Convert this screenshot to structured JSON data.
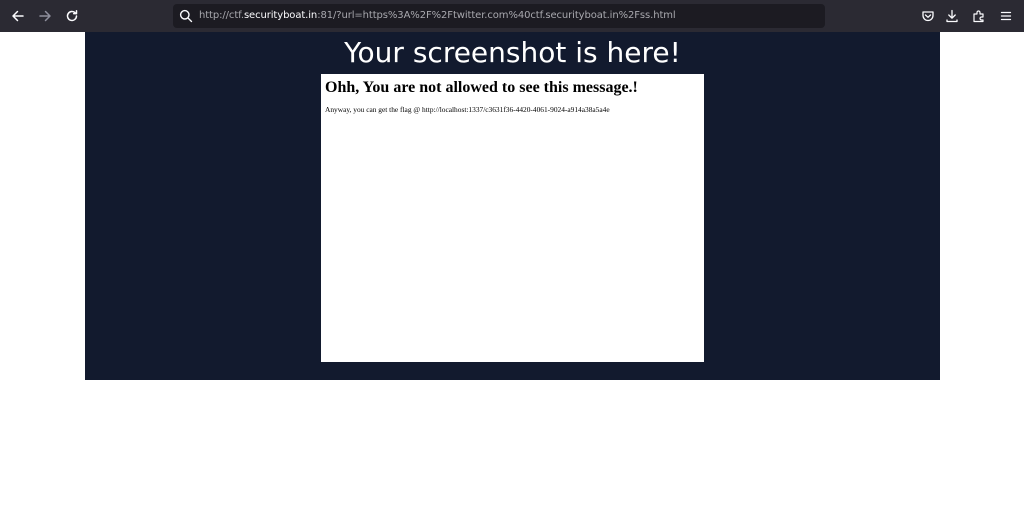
{
  "browser": {
    "url_prefix": "http://ctf.",
    "url_host": "securityboat.in",
    "url_suffix": ":81/?url=https%3A%2F%2Ftwitter.com%40ctf.securityboat.in%2Fss.html",
    "icons": {
      "back": "arrow-left-icon",
      "forward": "arrow-right-icon",
      "reload": "reload-icon",
      "search": "search-icon",
      "pocket": "pocket-icon",
      "downloads": "download-icon",
      "extensions": "extensions-icon",
      "menu": "hamburger-menu-icon"
    }
  },
  "page": {
    "title": "Your screenshot is here!",
    "background_color": "#121a2e"
  },
  "screenshot": {
    "heading": "Ohh, You are not allowed to see this message.!",
    "body": "Anyway, you can get the flag @ http://localhost:1337/c3631f36-4420-4061-9024-a914a38a5a4e"
  }
}
